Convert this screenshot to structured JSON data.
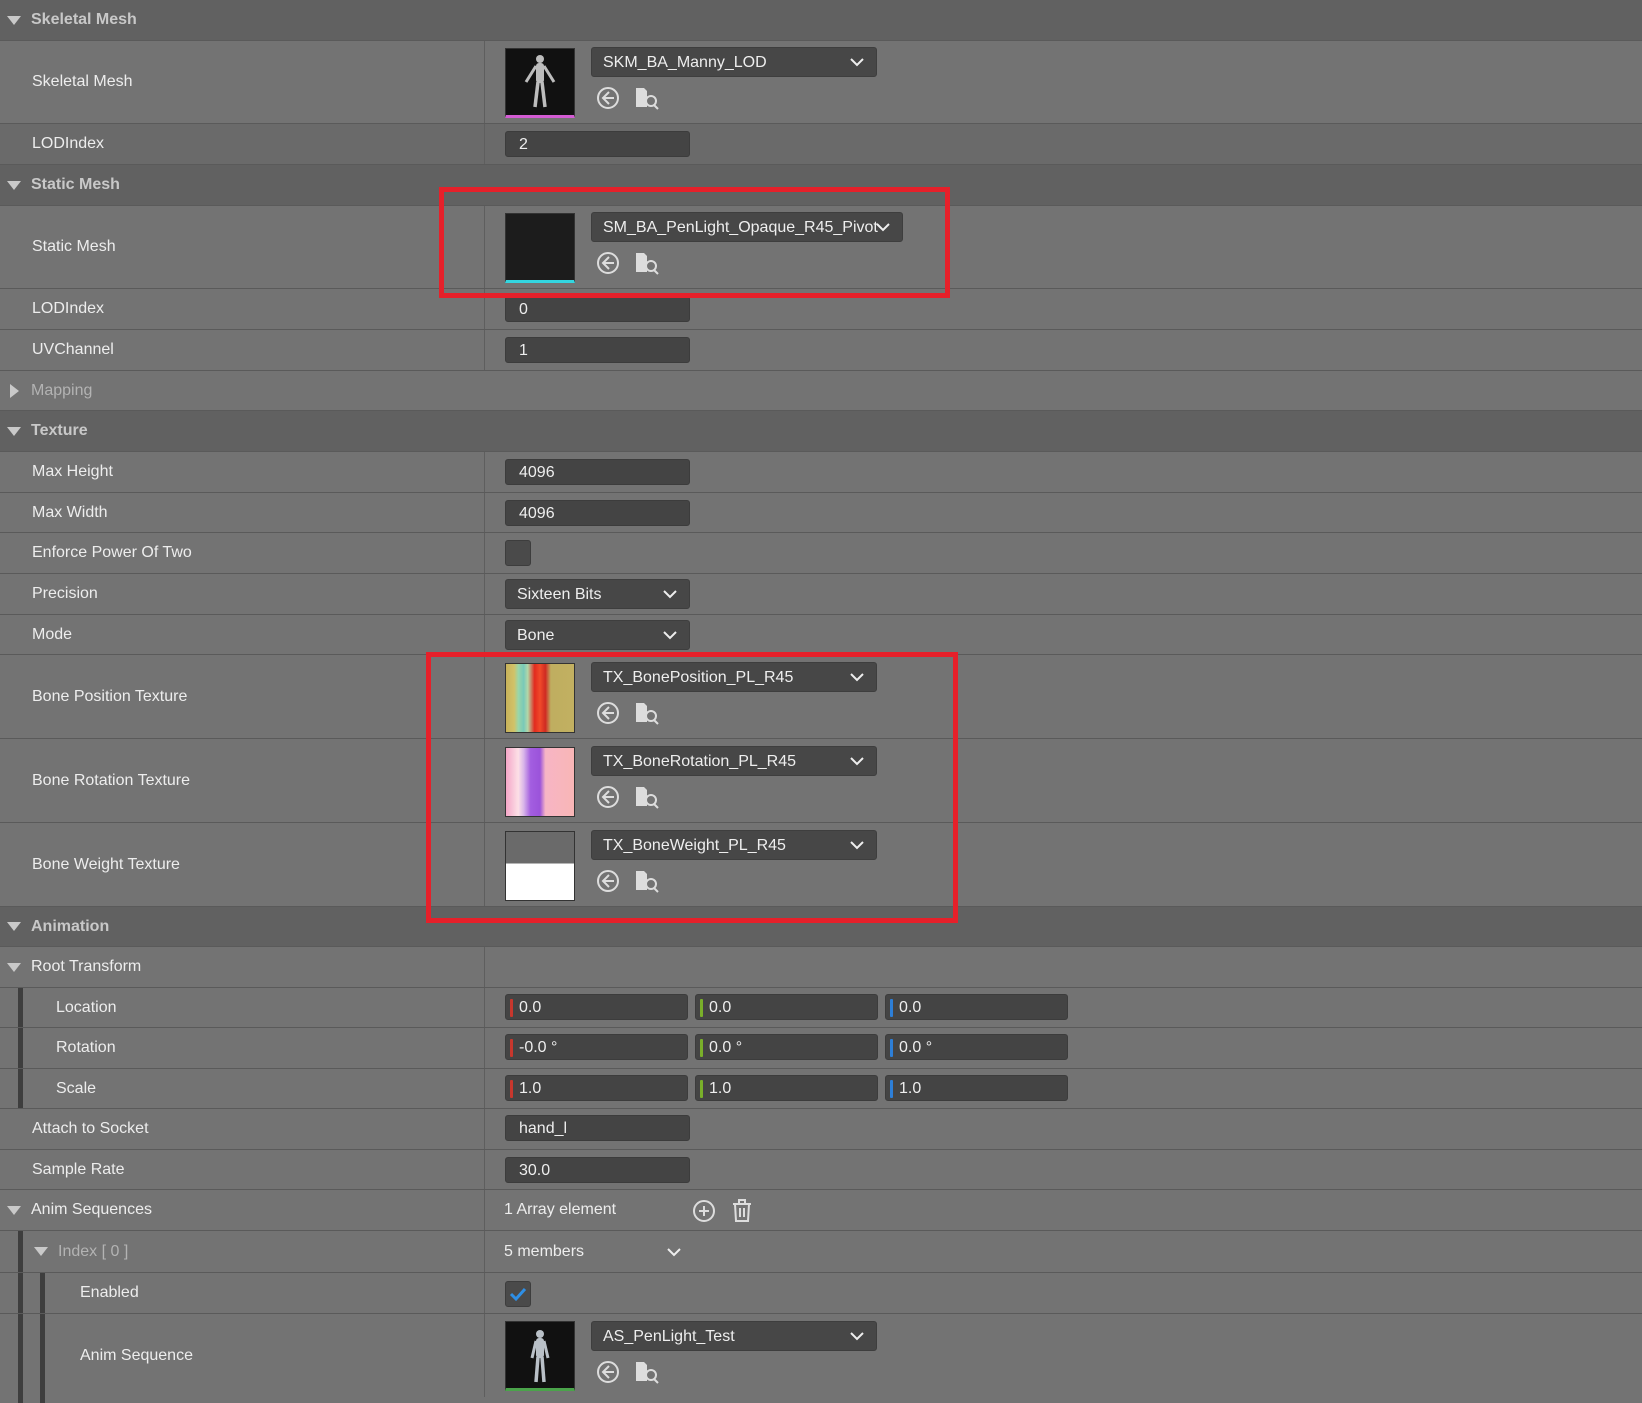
{
  "sections": {
    "skeletal_mesh": "Skeletal Mesh",
    "static_mesh": "Static Mesh",
    "mapping": "Mapping",
    "texture": "Texture",
    "animation": "Animation"
  },
  "skeletal_mesh": {
    "label": "Skeletal Mesh",
    "asset": "SKM_BA_Manny_LOD",
    "lod_label": "LODIndex",
    "lod_value": "2"
  },
  "static_mesh": {
    "label": "Static Mesh",
    "asset": "SM_BA_PenLight_Opaque_R45_Pivot",
    "lod_label": "LODIndex",
    "lod_value": "0",
    "uv_label": "UVChannel",
    "uv_value": "1"
  },
  "texture": {
    "max_height_label": "Max Height",
    "max_height": "4096",
    "max_width_label": "Max Width",
    "max_width": "4096",
    "enforce_label": "Enforce Power Of Two",
    "precision_label": "Precision",
    "precision": "Sixteen Bits",
    "mode_label": "Mode",
    "mode": "Bone",
    "bone_position_label": "Bone Position Texture",
    "bone_position": "TX_BonePosition_PL_R45",
    "bone_rotation_label": "Bone Rotation Texture",
    "bone_rotation": "TX_BoneRotation_PL_R45",
    "bone_weight_label": "Bone Weight Texture",
    "bone_weight": "TX_BoneWeight_PL_R45"
  },
  "animation": {
    "root_transform_label": "Root Transform",
    "location_label": "Location",
    "location": [
      "0.0",
      "0.0",
      "0.0"
    ],
    "rotation_label": "Rotation",
    "rotation": [
      "-0.0 °",
      "0.0 °",
      "0.0 °"
    ],
    "scale_label": "Scale",
    "scale": [
      "1.0",
      "1.0",
      "1.0"
    ],
    "socket_label": "Attach to Socket",
    "socket": "hand_l",
    "sample_rate_label": "Sample Rate",
    "sample_rate": "30.0",
    "anim_sequences_label": "Anim Sequences",
    "array_text": "1 Array element",
    "index_label": "Index [ 0 ]",
    "members_text": "5 members",
    "enabled_label": "Enabled",
    "enabled": true,
    "anim_sequence_label": "Anim Sequence",
    "anim_sequence": "AS_PenLight_Test"
  },
  "colors": {
    "highlight": "#e6202a",
    "axis_x": "#c8372d",
    "axis_y": "#7ab02a",
    "axis_z": "#2d7fd8",
    "check": "#2e8fe6"
  }
}
